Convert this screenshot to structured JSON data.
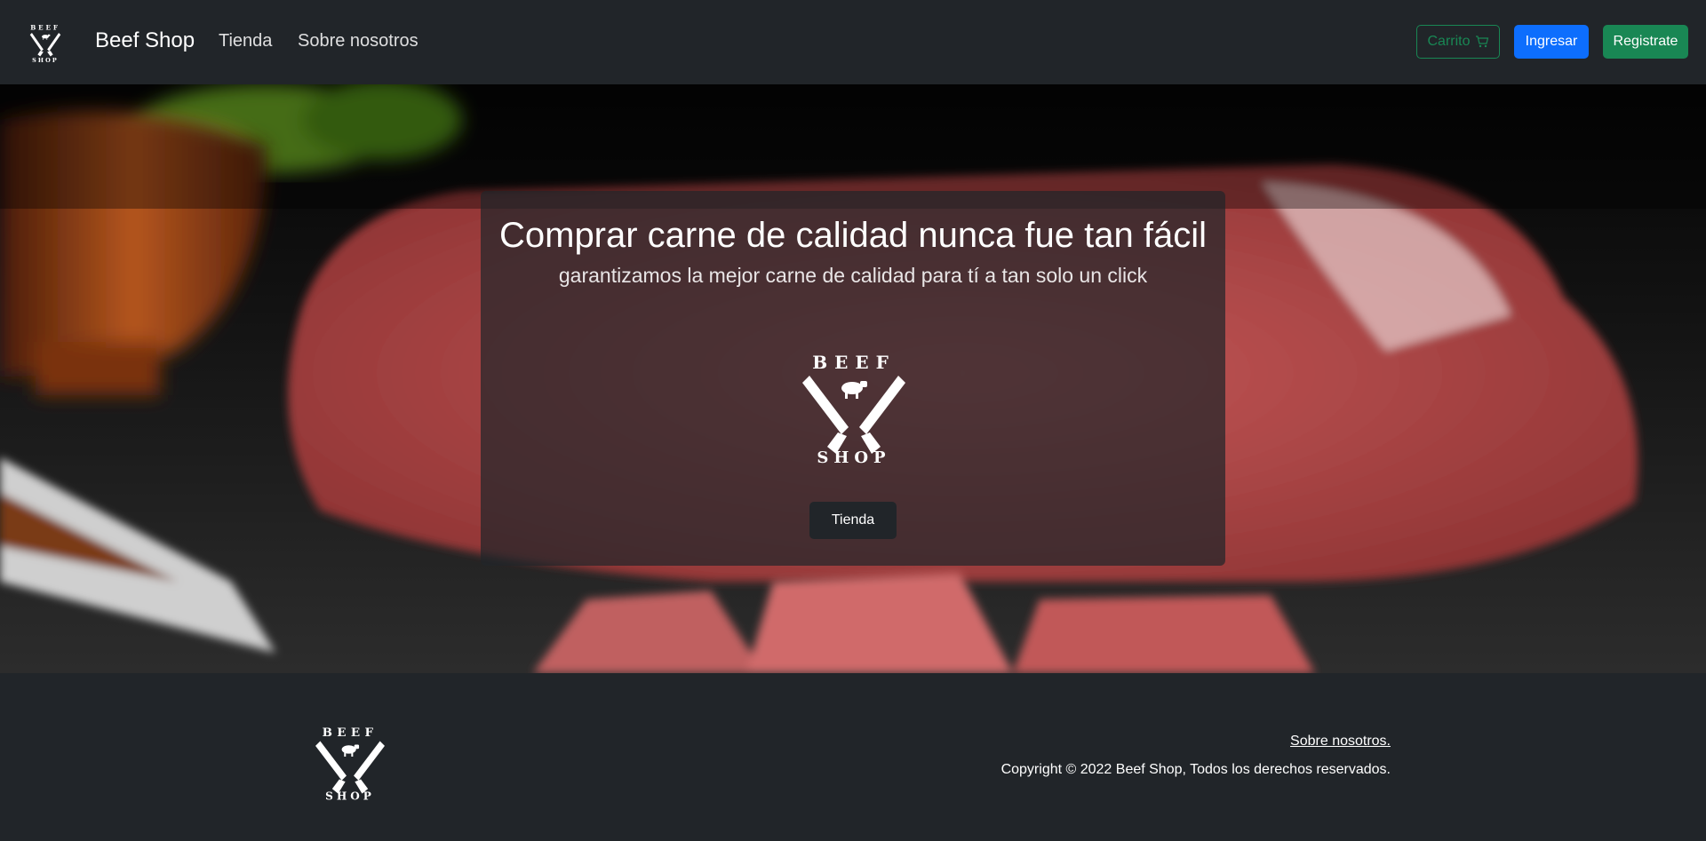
{
  "nav": {
    "brand": "Beef Shop",
    "links": [
      "Tienda",
      "Sobre nosotros"
    ],
    "cart_label": "Carrito",
    "login_label": "Ingresar",
    "register_label": "Registrate",
    "logo_top_text": "BEEF",
    "logo_bottom_text": "SHOP"
  },
  "hero": {
    "title": "Comprar carne de calidad nunca fue tan fácil",
    "subtitle": "garantizamos la mejor carne de calidad para tí a tan solo un click",
    "button_label": "Tienda",
    "logo_top_text": "BEEF",
    "logo_bottom_text": "SHOP"
  },
  "footer": {
    "about_link": "Sobre nosotros.",
    "copyright": "Copyright © 2022 Beef Shop, Todos los derechos reservados.",
    "logo_top_text": "BEEF",
    "logo_bottom_text": "SHOP"
  },
  "icons": {
    "cart": "cart-icon",
    "logo": "beef-shop-logo"
  },
  "colors": {
    "navbar_bg": "#212529",
    "primary": "#0d6efd",
    "success": "#198754"
  }
}
